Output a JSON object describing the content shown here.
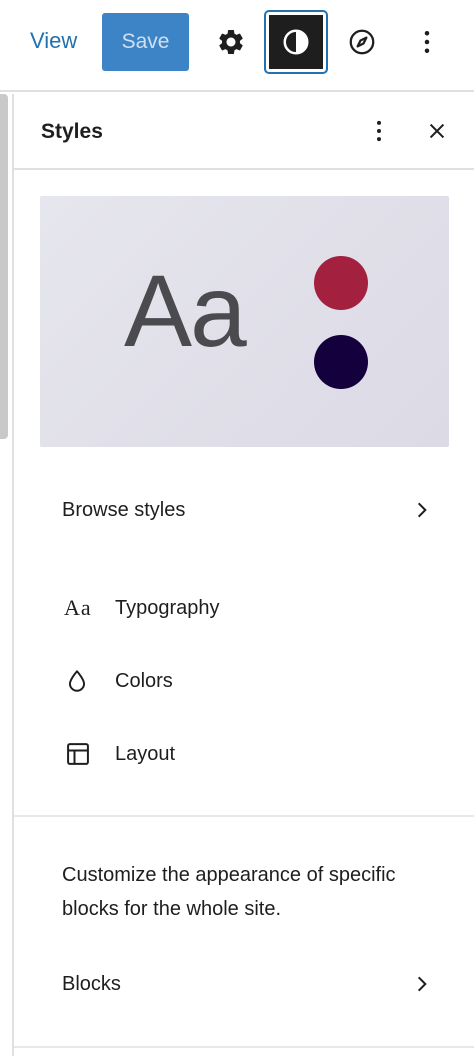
{
  "toolbar": {
    "view_label": "View",
    "save_label": "Save",
    "icons": [
      "gear-icon",
      "half-circle-styles-icon",
      "compass-icon",
      "more-vertical-icon"
    ]
  },
  "sidebar": {
    "title": "Styles",
    "preview": {
      "sample_text": "Aa",
      "colors": {
        "primary": "#a3213f",
        "secondary": "#13003d"
      }
    },
    "browse_label": "Browse styles",
    "nav_items": [
      {
        "label": "Typography",
        "icon_text": "Aa"
      },
      {
        "label": "Colors"
      },
      {
        "label": "Layout"
      }
    ],
    "description": "Customize the appearance of specific blocks for the whole site.",
    "blocks_label": "Blocks"
  }
}
